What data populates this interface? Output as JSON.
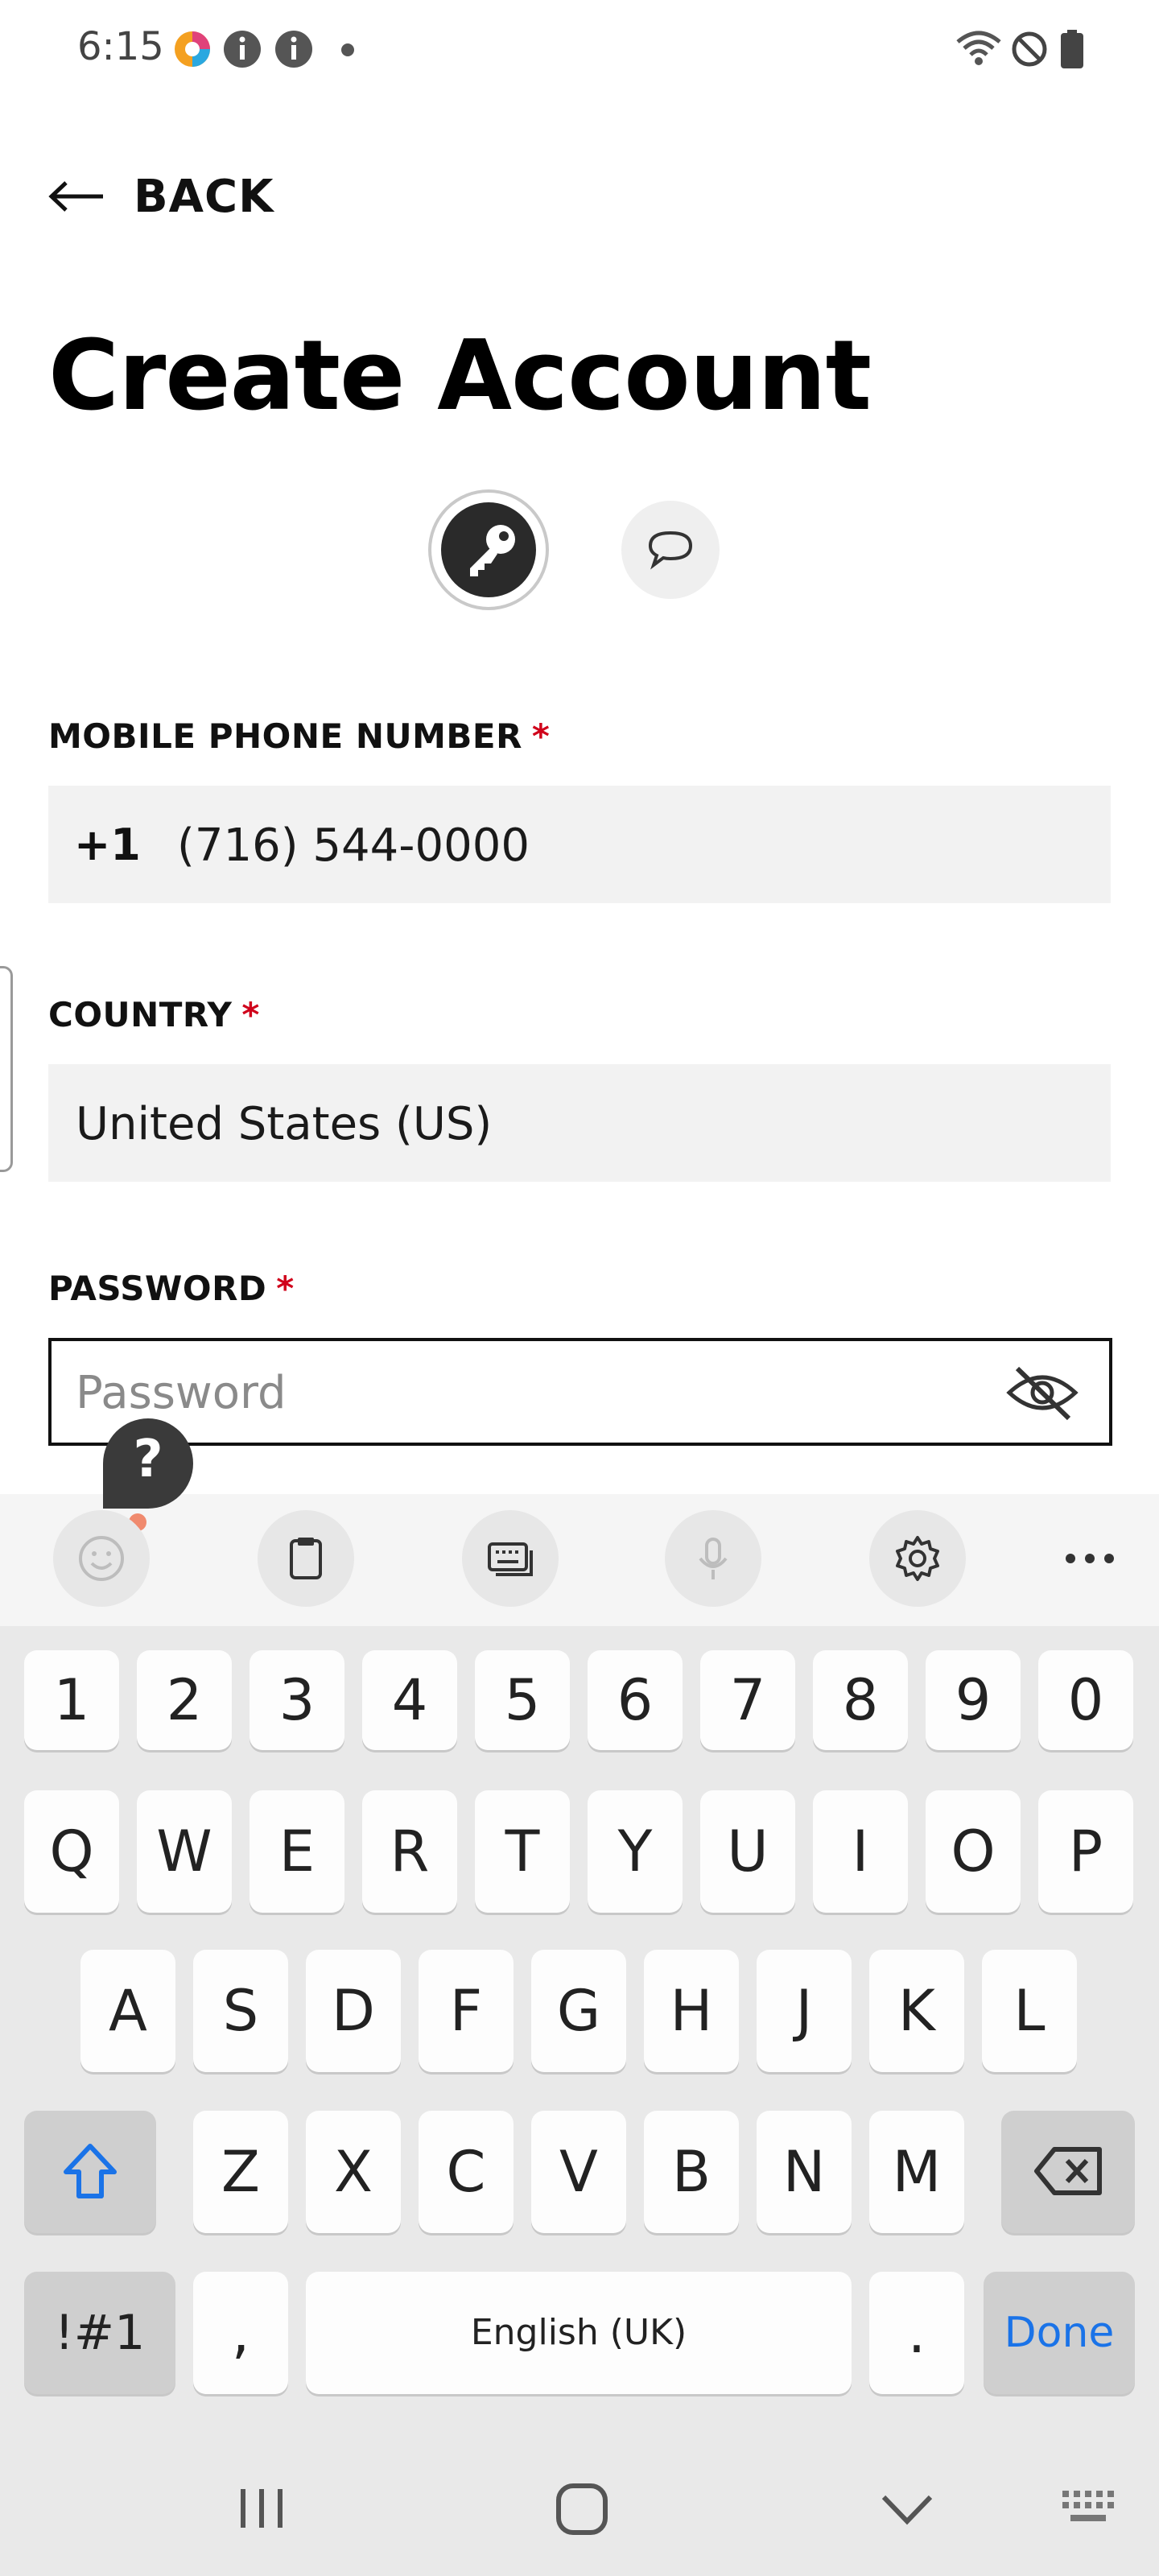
{
  "status_bar": {
    "time": "6:15"
  },
  "header": {
    "back_label": "BACK",
    "title": "Create Account"
  },
  "form": {
    "phone": {
      "label": "MOBILE PHONE NUMBER",
      "required_mark": "*",
      "country_code": "+1",
      "value": "(716) 544-0000"
    },
    "country": {
      "label": "COUNTRY",
      "required_mark": "*",
      "value": "United States (US)"
    },
    "password": {
      "label": "PASSWORD",
      "required_mark": "*",
      "placeholder": "Password",
      "value": ""
    }
  },
  "help": {
    "label": "?"
  },
  "keyboard": {
    "row_numbers": [
      "1",
      "2",
      "3",
      "4",
      "5",
      "6",
      "7",
      "8",
      "9",
      "0"
    ],
    "row_top": [
      "Q",
      "W",
      "E",
      "R",
      "T",
      "Y",
      "U",
      "I",
      "O",
      "P"
    ],
    "row_middle": [
      "A",
      "S",
      "D",
      "F",
      "G",
      "H",
      "J",
      "K",
      "L"
    ],
    "row_bottom": [
      "Z",
      "X",
      "C",
      "V",
      "B",
      "N",
      "M"
    ],
    "symbols_label": "!#1",
    "comma_label": ",",
    "space_label": "English (UK)",
    "period_label": ".",
    "done_label": "Done",
    "toolbar_icons": [
      "emoji-icon",
      "clipboard-icon",
      "keyboard-mode-icon",
      "microphone-icon",
      "settings-icon",
      "more-icon"
    ]
  },
  "colors": {
    "required": "#d0021b",
    "done_key": "#1a73e8",
    "keyboard_bg": "#e9e9e9",
    "field_bg": "#f2f2f2"
  }
}
